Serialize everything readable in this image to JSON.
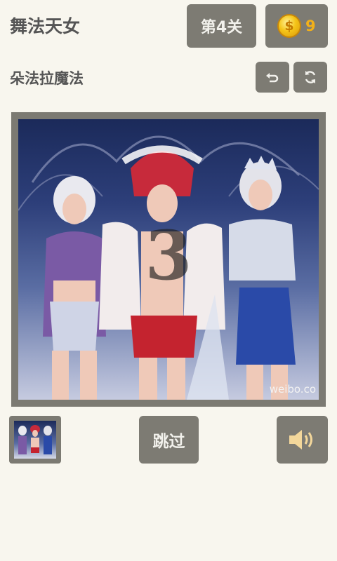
{
  "header": {
    "title": "舞法天女",
    "level_label": "第4关",
    "coins": "9",
    "coin_symbol": "$"
  },
  "puzzle": {
    "subtitle": "朵法拉魔法",
    "countdown": "3",
    "watermark": "weibo.co"
  },
  "footer": {
    "skip_label": "跳过"
  },
  "colors": {
    "background": "#f8f6ee",
    "button": "#7d7b73",
    "coin": "#f5c418",
    "coin_text": "#f2b019",
    "speaker": "#f3d79b"
  },
  "icons": {
    "undo": "undo-icon",
    "refresh": "refresh-icon",
    "sound": "speaker-icon",
    "coin": "coin-icon"
  }
}
